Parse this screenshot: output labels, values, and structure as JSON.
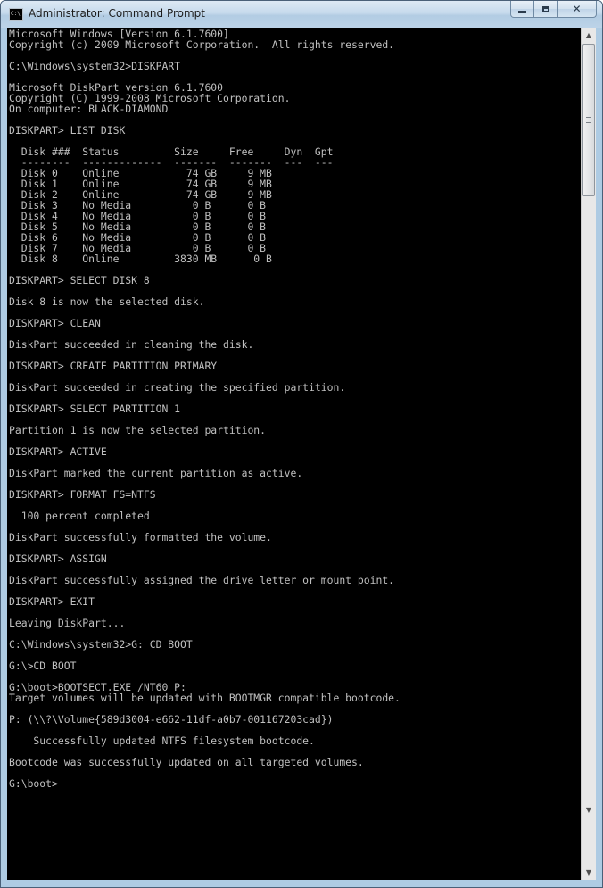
{
  "window": {
    "title": "Administrator: Command Prompt",
    "icon_label": "C:\\"
  },
  "caption_buttons": {
    "minimize_icon": "minimize-icon",
    "maximize_icon": "maximize-icon",
    "close_icon": "close-icon",
    "close_glyph": "✕"
  },
  "console": {
    "text": "Microsoft Windows [Version 6.1.7600]\nCopyright (c) 2009 Microsoft Corporation.  All rights reserved.\n\nC:\\Windows\\system32>DISKPART\n\nMicrosoft DiskPart version 6.1.7600\nCopyright (C) 1999-2008 Microsoft Corporation.\nOn computer: BLACK-DIAMOND\n\nDISKPART> LIST DISK\n\n  Disk ###  Status         Size     Free     Dyn  Gpt\n  --------  -------------  -------  -------  ---  ---\n  Disk 0    Online           74 GB     9 MB\n  Disk 1    Online           74 GB     9 MB\n  Disk 2    Online           74 GB     9 MB\n  Disk 3    No Media          0 B      0 B\n  Disk 4    No Media          0 B      0 B\n  Disk 5    No Media          0 B      0 B\n  Disk 6    No Media          0 B      0 B\n  Disk 7    No Media          0 B      0 B\n  Disk 8    Online         3830 MB      0 B\n\nDISKPART> SELECT DISK 8\n\nDisk 8 is now the selected disk.\n\nDISKPART> CLEAN\n\nDiskPart succeeded in cleaning the disk.\n\nDISKPART> CREATE PARTITION PRIMARY\n\nDiskPart succeeded in creating the specified partition.\n\nDISKPART> SELECT PARTITION 1\n\nPartition 1 is now the selected partition.\n\nDISKPART> ACTIVE\n\nDiskPart marked the current partition as active.\n\nDISKPART> FORMAT FS=NTFS\n\n  100 percent completed\n\nDiskPart successfully formatted the volume.\n\nDISKPART> ASSIGN\n\nDiskPart successfully assigned the drive letter or mount point.\n\nDISKPART> EXIT\n\nLeaving DiskPart...\n\nC:\\Windows\\system32>G: CD BOOT\n\nG:\\>CD BOOT\n\nG:\\boot>BOOTSECT.EXE /NT60 P:\nTarget volumes will be updated with BOOTMGR compatible bootcode.\n\nP: (\\\\?\\Volume{589d3004-e662-11df-a0b7-001167203cad})\n\n    Successfully updated NTFS filesystem bootcode.\n\nBootcode was successfully updated on all targeted volumes.\n\nG:\\boot>"
  },
  "scrollbar": {
    "up_glyph": "▲",
    "down_glyph": "▼",
    "lower_glyph": "▼"
  },
  "colors": {
    "console_bg": "#000000",
    "console_fg": "#c0c0c0",
    "frame": "#aecbe3"
  }
}
